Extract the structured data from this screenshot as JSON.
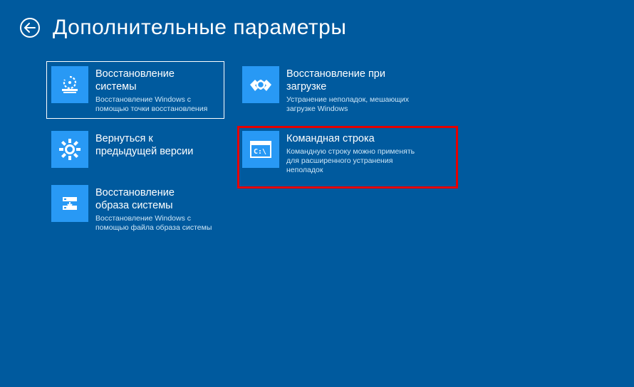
{
  "title": "Дополнительные параметры",
  "tiles": {
    "systemRestore": {
      "title": "Восстановление\nсистемы",
      "desc": "Восстановление Windows с\nпомощью точки восстановления"
    },
    "rollback": {
      "title": "Вернуться к\nпредыдущей версии",
      "desc": ""
    },
    "imageRecovery": {
      "title": "Восстановление\nобраза системы",
      "desc": "Восстановление Windows с\nпомощью файла образа системы"
    },
    "startupRepair": {
      "title": "Восстановление при\nзагрузке",
      "desc": "Устранение неполадок, мешающих\nзагрузке Windows"
    },
    "commandPrompt": {
      "title": "Командная строка",
      "desc": "Командную строку можно применять\nдля расширенного устранения\nнеполадок"
    }
  }
}
